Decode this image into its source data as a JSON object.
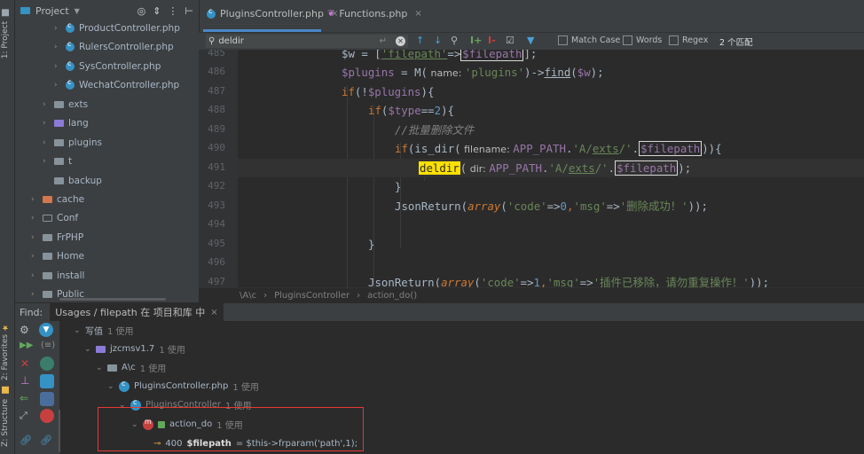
{
  "left_strip": {
    "project_tab": "1: Project",
    "favorites_tab": "2: Favorites",
    "structure_tab": "Z: Structure"
  },
  "project_panel": {
    "title": "Project",
    "tree": [
      {
        "label": "ProductController.php",
        "type": "class",
        "arrow": "›"
      },
      {
        "label": "RulersController.php",
        "type": "class",
        "arrow": "›"
      },
      {
        "label": "SysController.php",
        "type": "class",
        "arrow": "›"
      },
      {
        "label": "WechatController.php",
        "type": "class",
        "arrow": "›"
      },
      {
        "label": "exts",
        "type": "folder",
        "arrow": "›"
      },
      {
        "label": "lang",
        "type": "folder-purple",
        "arrow": "›"
      },
      {
        "label": "plugins",
        "type": "folder",
        "arrow": "›"
      },
      {
        "label": "t",
        "type": "folder",
        "arrow": "›"
      },
      {
        "label": "backup",
        "type": "folder",
        "arrow": ""
      },
      {
        "label": "cache",
        "type": "folder-orange",
        "arrow": "›"
      },
      {
        "label": "Conf",
        "type": "folder-outline",
        "arrow": "›"
      },
      {
        "label": "FrPHP",
        "type": "folder",
        "arrow": "›"
      },
      {
        "label": "Home",
        "type": "folder",
        "arrow": "›"
      },
      {
        "label": "install",
        "type": "folder",
        "arrow": "›"
      },
      {
        "label": "Public",
        "type": "folder",
        "arrow": "›"
      }
    ]
  },
  "editor": {
    "tabs": [
      {
        "label": "PluginsController.php",
        "active": true
      },
      {
        "label": "Functions.php",
        "active": false
      }
    ],
    "search": {
      "value": "deldir",
      "match_case": "Match Case",
      "words": "Words",
      "regex": "Regex",
      "count": "2 个匹配"
    },
    "line_numbers": [
      "485",
      "486",
      "487",
      "488",
      "489",
      "490",
      "491",
      "492",
      "493",
      "494",
      "495",
      "496",
      "497"
    ],
    "code_lines": {
      "l485_a": "$w = [",
      "l485_b": "'filepath'",
      "l485_c": "=>",
      "l485_d": "$filepath",
      "l485_e": "];",
      "l486_a": "$plugins",
      "l486_b": " = ",
      "l486_c": "M(",
      "l486_d": " name: ",
      "l486_e": "'plugins'",
      "l486_f": ")->",
      "l486_g": "find",
      "l486_h": "(",
      "l486_i": "$w",
      "l486_j": ");",
      "l487_a": "if",
      "l487_b": "(!",
      "l487_c": "$plugins",
      "l487_d": "){",
      "l488_a": "if",
      "l488_b": "(",
      "l488_c": "$type",
      "l488_d": "==",
      "l488_e": "2",
      "l488_f": "){",
      "l489_a": "//批量删除文件",
      "l490_a": "if",
      "l490_b": "(",
      "l490_c": "is_dir",
      "l490_d": "(",
      "l490_e": " filename: ",
      "l490_f": "APP_PATH",
      "l490_g": ".",
      "l490_h": "'A/",
      "l490_i": "exts",
      "l490_j": "/'",
      "l490_k": ".",
      "l490_l": "$filepath",
      "l490_m": ")){",
      "l491_a": "deldir",
      "l491_b": "(",
      "l491_c": " dir: ",
      "l491_d": "APP_PATH",
      "l491_e": ".",
      "l491_f": "'A/",
      "l491_g": "exts",
      "l491_h": "/'",
      "l491_i": ".",
      "l491_j": "$filepath",
      "l491_k": ");",
      "l492_a": "}",
      "l493_a": "JsonReturn",
      "l493_b": "(",
      "l493_c": "array",
      "l493_d": "(",
      "l493_e": "'code'",
      "l493_f": "=>",
      "l493_g": "0",
      "l493_h": ",",
      "l493_i": "'msg'",
      "l493_j": "=>",
      "l493_k": "'删除成功！'",
      "l493_l": "));",
      "l495_a": "}",
      "l497_a": "JsonReturn",
      "l497_b": "(",
      "l497_c": "array",
      "l497_d": "(",
      "l497_e": "'code'",
      "l497_f": "=>",
      "l497_g": "1",
      "l497_h": ",",
      "l497_i": "'msg'",
      "l497_j": "=>",
      "l497_k": "'插件已移除，请勿重复操作！'",
      "l497_l": "));"
    },
    "breadcrumbs": [
      "\\A\\c",
      "PluginsController",
      "action_do()"
    ]
  },
  "find_panel": {
    "title": "Find:",
    "tab_label": "Usages / filepath 在 项目和库 中",
    "tree": [
      {
        "label": "写值",
        "count": "1 使用"
      },
      {
        "label": "jzcmsv1.7",
        "count": "1 使用"
      },
      {
        "label": "A\\c",
        "count": "1 使用"
      },
      {
        "label": "PluginsController.php",
        "count": "1 使用"
      },
      {
        "label": "PluginsController",
        "count": "1 使用"
      },
      {
        "label": "action_do",
        "count": "1 使用"
      }
    ],
    "usage_line": {
      "number": "400",
      "var": "$filepath",
      "rest": " = $this->frparam('path',1);"
    }
  }
}
